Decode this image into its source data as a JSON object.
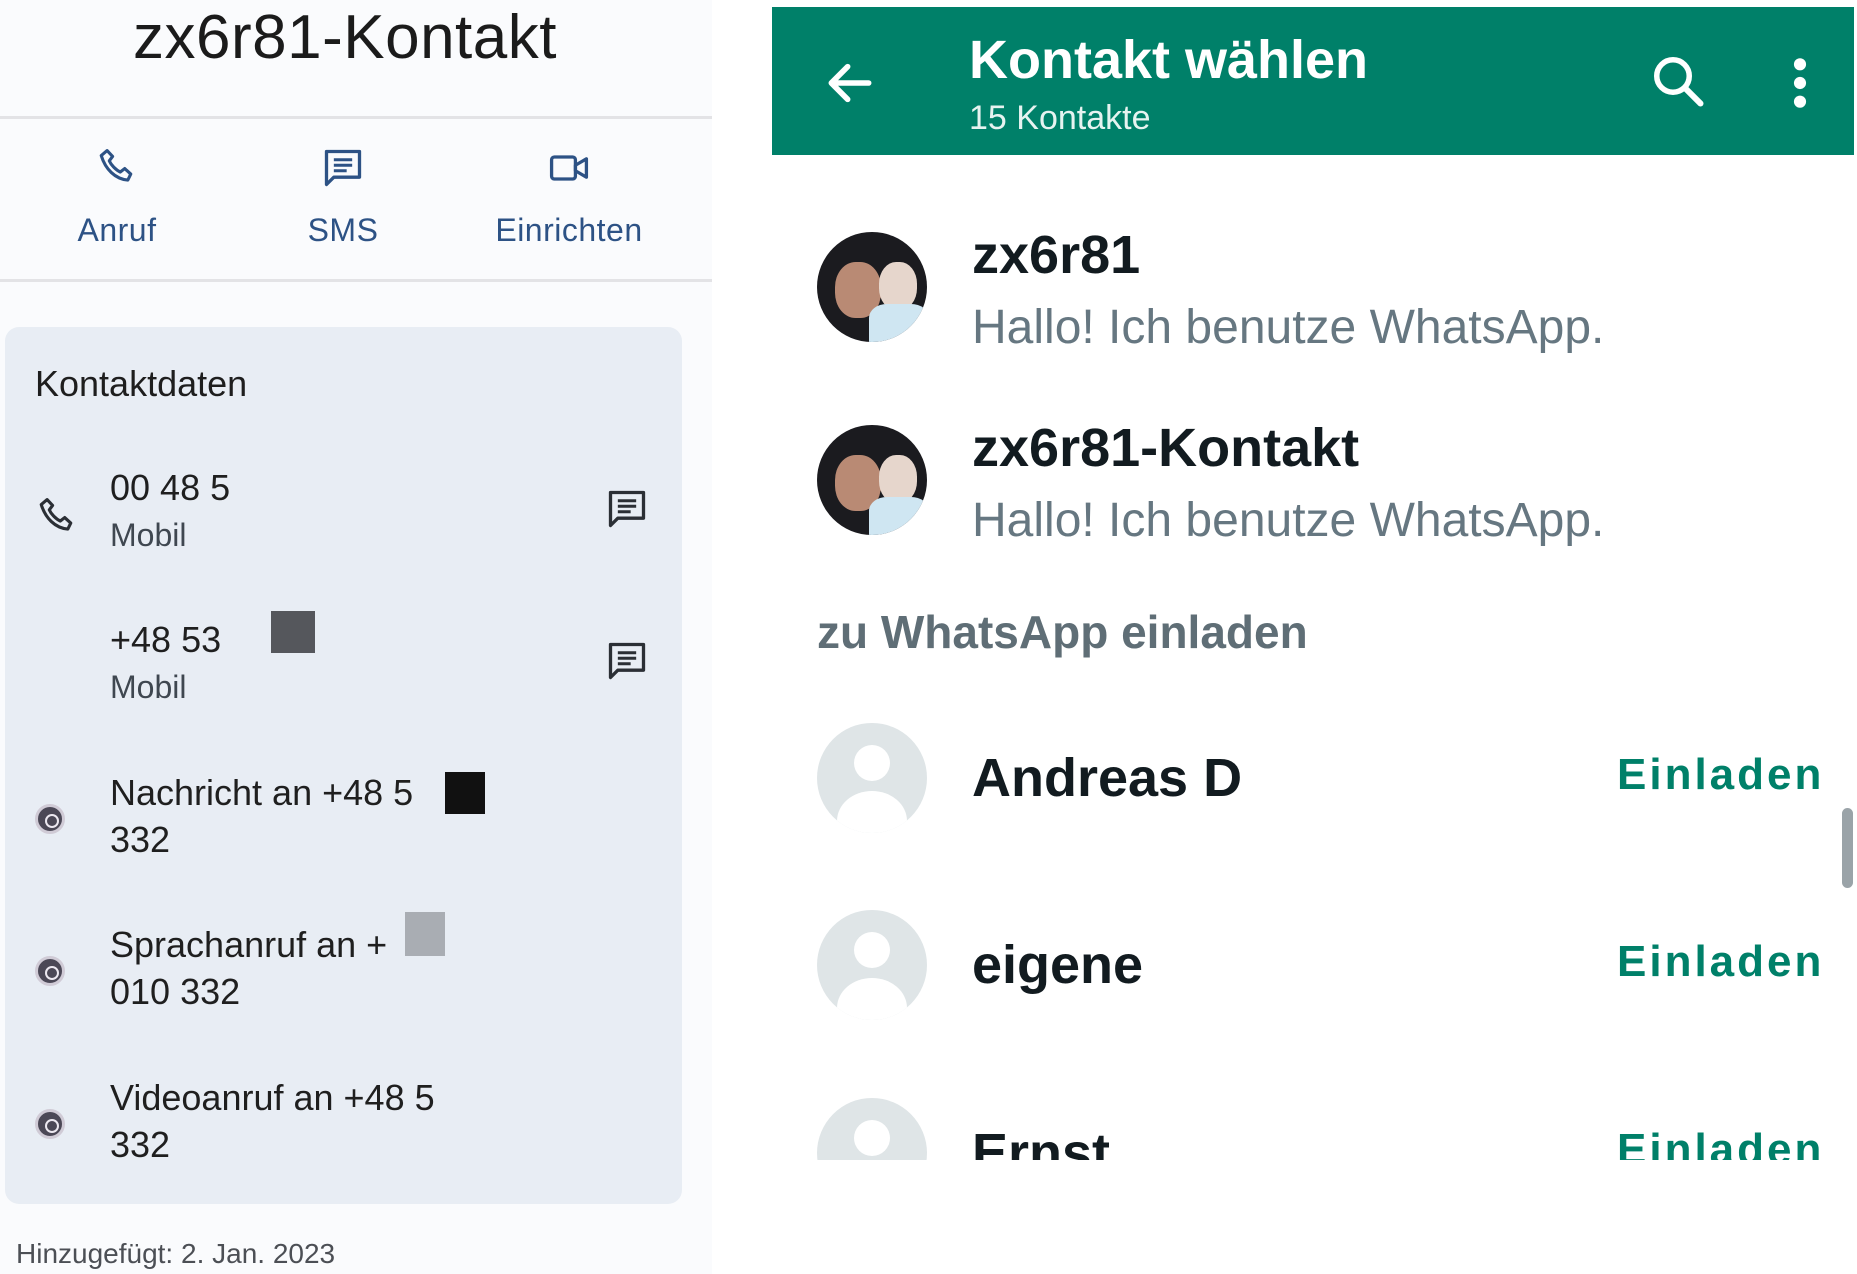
{
  "left": {
    "contact_name": "zx6r81-Kontakt",
    "actions": [
      {
        "label": "Anruf",
        "icon": "phone-icon"
      },
      {
        "label": "SMS",
        "icon": "message-icon"
      },
      {
        "label": "Einrichten",
        "icon": "video-icon"
      }
    ],
    "card_title": "Kontaktdaten",
    "numbers": [
      {
        "line1": "00 48 5",
        "line2": "Mobil"
      },
      {
        "line1": "+48 53",
        "line2": "Mobil"
      }
    ],
    "whatsapp_actions": [
      {
        "line1": "Nachricht an +48 5",
        "line2": "332"
      },
      {
        "line1": "Sprachanruf an +",
        "line2": "010 332"
      },
      {
        "line1": "Videoanruf an +48 5",
        "line2": "332"
      }
    ],
    "added": "Hinzugefügt: 2. Jan. 2023"
  },
  "right": {
    "title": "Kontakt wählen",
    "subtitle": "15 Kontakte",
    "contacts": [
      {
        "name": "zx6r81",
        "status": "Hallo! Ich benutze WhatsApp."
      },
      {
        "name": "zx6r81-Kontakt",
        "status": "Hallo! Ich benutze WhatsApp."
      }
    ],
    "invite_section": "zu WhatsApp einladen",
    "invite_contacts": [
      {
        "name": "Andreas D",
        "button": "Einladen"
      },
      {
        "name": "eigene",
        "button": "Einladen"
      },
      {
        "name": "Ernst",
        "button": "Einladen"
      }
    ]
  },
  "colors": {
    "whatsapp_green": "#008069",
    "link_blue": "#2d5285",
    "card_bg": "#e8edf4",
    "status_gray": "#667781"
  }
}
